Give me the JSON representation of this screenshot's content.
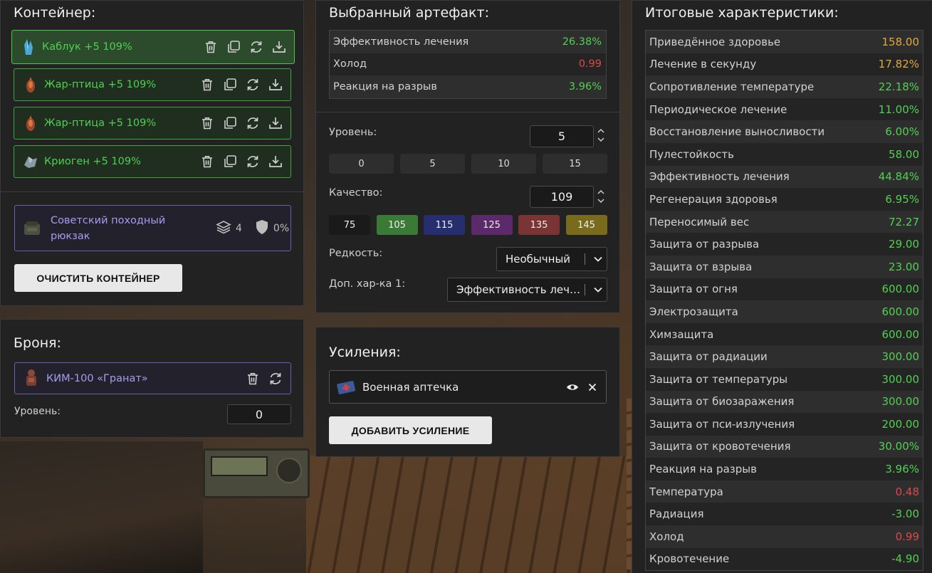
{
  "container": {
    "title": "Контейнер:",
    "artifacts": [
      {
        "name": "Каблук +5 109%",
        "icon": "crystal-icon",
        "active": true
      },
      {
        "name": "Жар-птица +5 109%",
        "icon": "firebird-icon",
        "active": false
      },
      {
        "name": "Жар-птица +5 109%",
        "icon": "firebird-icon",
        "active": false
      },
      {
        "name": "Криоген +5 109%",
        "icon": "cryogen-icon",
        "active": false
      }
    ],
    "backpack": {
      "name": "Советский походный рюкзак",
      "slots": "4",
      "protection": "0%"
    },
    "clear_button": "ОЧИСТИТЬ КОНТЕЙНЕР"
  },
  "armor": {
    "title": "Броня:",
    "item_name": "КИМ-100 «Гранат»",
    "level_label": "Уровень:",
    "level_value": "0"
  },
  "artifact": {
    "title": "Выбранный артефакт:",
    "stats": [
      {
        "label": "Эффективность лечения",
        "value": "26.38%",
        "color": "green"
      },
      {
        "label": "Холод",
        "value": "0.99",
        "color": "red"
      },
      {
        "label": "Реакция на разрыв",
        "value": "3.96%",
        "color": "green"
      }
    ],
    "level_label": "Уровень:",
    "level_value": "5",
    "level_presets": [
      "0",
      "5",
      "10",
      "15"
    ],
    "quality_label": "Качество:",
    "quality_value": "109",
    "quality_presets": [
      {
        "label": "75",
        "color": "#1a1a1a"
      },
      {
        "label": "105",
        "color": "#3a7a36"
      },
      {
        "label": "115",
        "color": "#262e6e"
      },
      {
        "label": "125",
        "color": "#5c2a6a"
      },
      {
        "label": "135",
        "color": "#7a3434"
      },
      {
        "label": "145",
        "color": "#7a6a1c"
      }
    ],
    "rarity_label": "Редкость:",
    "rarity_value": "Необычный",
    "extra_label": "Доп. хар-ка 1:",
    "extra_value": "Эффективность лечения"
  },
  "boosts": {
    "title": "Усиления:",
    "item_name": "Военная аптечка",
    "add_button": "ДОБАВИТЬ УСИЛЕНИЕ"
  },
  "totals": {
    "title": "Итоговые характеристики:",
    "rows": [
      {
        "label": "Приведённое здоровье",
        "value": "158.00",
        "color": "orange"
      },
      {
        "label": "Лечение в секунду",
        "value": "17.82%",
        "color": "orange"
      },
      {
        "label": "Сопротивление температуре",
        "value": "22.18%",
        "color": "green"
      },
      {
        "label": "Периодическое лечение",
        "value": "11.00%",
        "color": "green"
      },
      {
        "label": "Восстановление выносливости",
        "value": "6.00%",
        "color": "green"
      },
      {
        "label": "Пулестойкость",
        "value": "58.00",
        "color": "green"
      },
      {
        "label": "Эффективность лечения",
        "value": "44.84%",
        "color": "green"
      },
      {
        "label": "Регенерация здоровья",
        "value": "6.95%",
        "color": "green"
      },
      {
        "label": "Переносимый вес",
        "value": "72.27",
        "color": "green"
      },
      {
        "label": "Защита от разрыва",
        "value": "29.00",
        "color": "green"
      },
      {
        "label": "Защита от взрыва",
        "value": "23.00",
        "color": "green"
      },
      {
        "label": "Защита от огня",
        "value": "600.00",
        "color": "green"
      },
      {
        "label": "Электрозащита",
        "value": "600.00",
        "color": "green"
      },
      {
        "label": "Химзащита",
        "value": "600.00",
        "color": "green"
      },
      {
        "label": "Защита от радиации",
        "value": "300.00",
        "color": "green"
      },
      {
        "label": "Защита от температуры",
        "value": "300.00",
        "color": "green"
      },
      {
        "label": "Защита от биозаражения",
        "value": "300.00",
        "color": "green"
      },
      {
        "label": "Защита от пси-излучения",
        "value": "200.00",
        "color": "green"
      },
      {
        "label": "Защита от кровотечения",
        "value": "30.00%",
        "color": "green"
      },
      {
        "label": "Реакция на разрыв",
        "value": "3.96%",
        "color": "green"
      },
      {
        "label": "Температура",
        "value": "0.48",
        "color": "red"
      },
      {
        "label": "Радиация",
        "value": "-3.00",
        "color": "green"
      },
      {
        "label": "Холод",
        "value": "0.99",
        "color": "red"
      },
      {
        "label": "Кровотечение",
        "value": "-4.90",
        "color": "green"
      }
    ]
  }
}
